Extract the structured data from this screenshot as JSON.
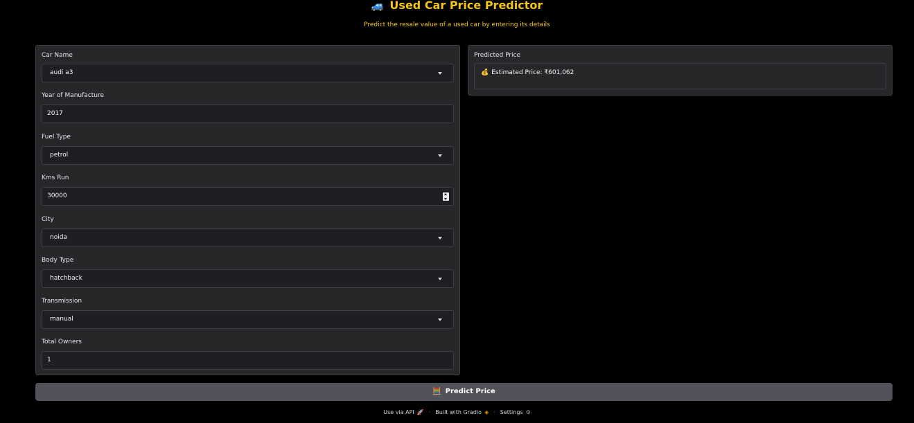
{
  "header": {
    "title_icon": "🚙",
    "title": "Used Car Price Predictor",
    "subtitle": "Predict the resale value of a used car by entering its details"
  },
  "form": {
    "car_name": {
      "label": "Car Name",
      "value": "audi a3",
      "type": "dropdown"
    },
    "year": {
      "label": "Year of Manufacture",
      "value": "2017",
      "type": "textbox"
    },
    "fuel_type": {
      "label": "Fuel Type",
      "value": "petrol",
      "type": "dropdown"
    },
    "kms_run": {
      "label": "Kms Run",
      "value": "30000",
      "type": "number"
    },
    "city": {
      "label": "City",
      "value": "noida",
      "type": "dropdown"
    },
    "body_type": {
      "label": "Body Type",
      "value": "hatchback",
      "type": "dropdown"
    },
    "transmission": {
      "label": "Transmission",
      "value": "manual",
      "type": "dropdown"
    },
    "total_owners": {
      "label": "Total Owners",
      "value": "1",
      "type": "textbox"
    }
  },
  "output": {
    "label": "Predicted Price",
    "icon": "💰",
    "text": "Estimated Price: ₹601,062"
  },
  "actions": {
    "predict_icon": "🧮",
    "predict_label": "Predict Price"
  },
  "footer": {
    "api_label": "Use via API",
    "api_icon": "rocket-icon",
    "gradio_label": "Built with Gradio",
    "gradio_icon": "gradio-logo-icon",
    "settings_label": "Settings",
    "settings_icon": "gear-icon",
    "separator": "·"
  },
  "colors": {
    "accent": "#f5c518",
    "panel_bg": "#27272a",
    "button_bg": "#52525b",
    "page_bg": "#000000"
  }
}
